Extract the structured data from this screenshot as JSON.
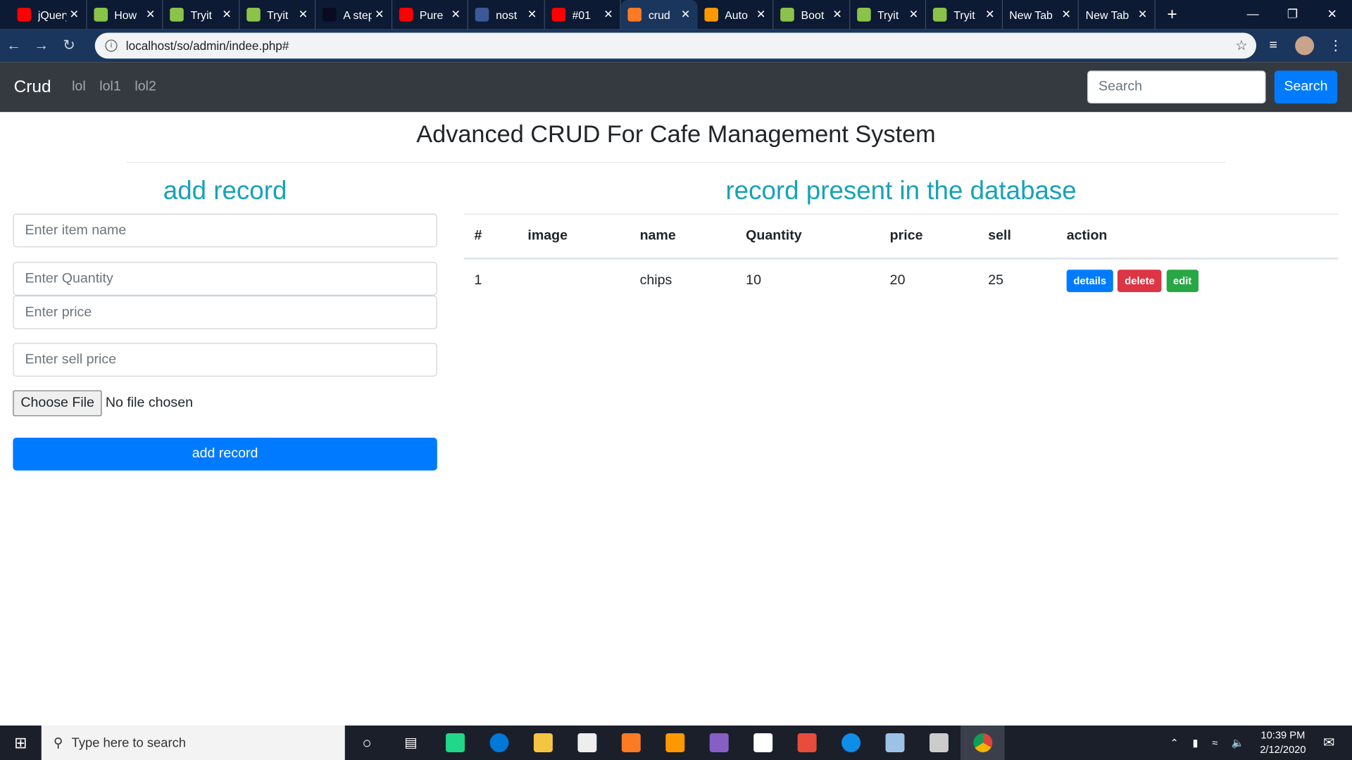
{
  "browser": {
    "tabs": [
      {
        "title": "jQuery",
        "icon": "youtube-icon",
        "color": "#ff0000"
      },
      {
        "title": "How",
        "icon": "w3schools-icon",
        "color": "#8bc34a"
      },
      {
        "title": "Tryit",
        "icon": "w3schools-icon",
        "color": "#8bc34a"
      },
      {
        "title": "Tryit",
        "icon": "w3schools-icon",
        "color": "#8bc34a"
      },
      {
        "title": "A step",
        "icon": "freecodecamp-icon",
        "color": "#0a0a23"
      },
      {
        "title": "Pure",
        "icon": "youtube-icon",
        "color": "#ff0000"
      },
      {
        "title": "nost",
        "icon": "facebook-icon",
        "color": "#3b5998"
      },
      {
        "title": "#01",
        "icon": "youtube-icon",
        "color": "#ff0000"
      },
      {
        "title": "crud",
        "icon": "xampp-icon",
        "color": "#fb7a24",
        "active": true
      },
      {
        "title": "Auto",
        "icon": "sublime-icon",
        "color": "#ff9800"
      },
      {
        "title": "Boot",
        "icon": "w3schools-icon",
        "color": "#8bc34a"
      },
      {
        "title": "Tryit",
        "icon": "w3schools-icon",
        "color": "#8bc34a"
      },
      {
        "title": "Tryit",
        "icon": "w3schools-icon",
        "color": "#8bc34a"
      },
      {
        "title": "New Tab",
        "icon": "",
        "color": ""
      },
      {
        "title": "New Tab",
        "icon": "",
        "color": ""
      }
    ],
    "url": "localhost/so/admin/indee.php#"
  },
  "navbar": {
    "brand": "Crud",
    "links": [
      "lol",
      "lol1",
      "lol2"
    ],
    "search_placeholder": "Search",
    "search_button": "Search"
  },
  "page_title": "Advanced CRUD For Cafe Management System",
  "form": {
    "heading": "add record",
    "item_placeholder": "Enter item name",
    "quantity_placeholder": "Enter Quantity",
    "price_placeholder": "Enter price",
    "sell_placeholder": "Enter sell price",
    "choose_file": "Choose File",
    "no_file": "No file chosen",
    "submit": "add record"
  },
  "records": {
    "heading": "record present in the database",
    "columns": [
      "#",
      "image",
      "name",
      "Quantity",
      "price",
      "sell",
      "action"
    ],
    "rows": [
      {
        "id": "1",
        "image": "",
        "name": "chips",
        "quantity": "10",
        "price": "20",
        "sell": "25"
      }
    ],
    "actions": {
      "details": "details",
      "delete": "delete",
      "edit": "edit"
    }
  },
  "colors": {
    "primary": "#007bff",
    "danger": "#dc3545",
    "success": "#28a745",
    "info": "#17a2b8",
    "navbar": "#343a40"
  },
  "taskbar": {
    "search_placeholder": "Type here to search",
    "time": "10:39 PM",
    "date": "2/12/2020"
  }
}
